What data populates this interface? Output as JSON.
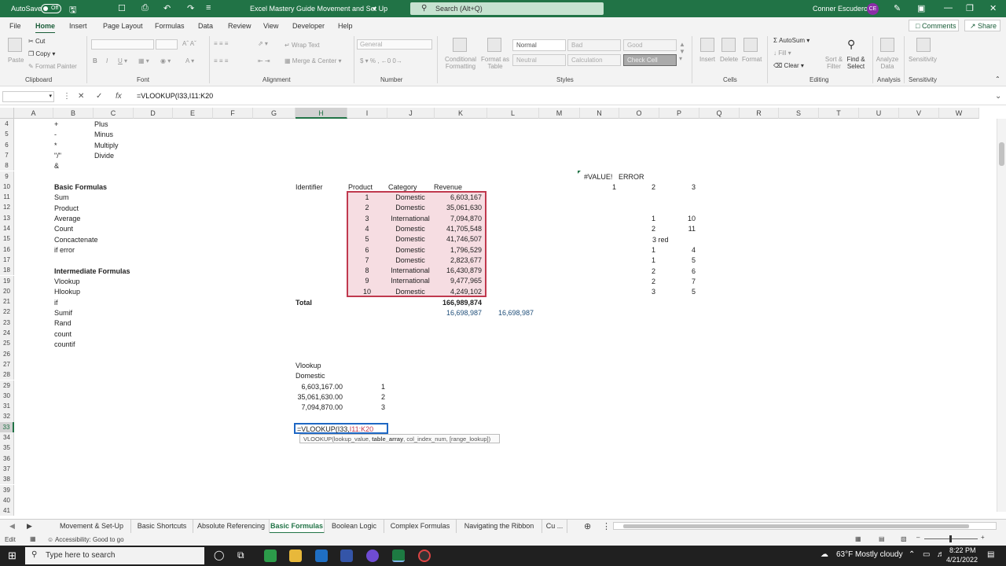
{
  "titlebar": {
    "autosave": "AutoSave",
    "autosave_state": "Off",
    "doc_title": "Excel Mastery Guide Movement and Set Up",
    "search_placeholder": "Search (Alt+Q)",
    "user_name": "Conner Escudero",
    "user_initials": "CE"
  },
  "menu": {
    "items": [
      "File",
      "Home",
      "Insert",
      "Page Layout",
      "Formulas",
      "Data",
      "Review",
      "View",
      "Developer",
      "Help"
    ],
    "comments": "Comments",
    "share": "Share"
  },
  "ribbon": {
    "clipboard": {
      "paste": "Paste",
      "cut": "Cut",
      "copy": "Copy",
      "format_painter": "Format Painter",
      "group": "Clipboard"
    },
    "font": {
      "group": "Font"
    },
    "alignment": {
      "wrap": "Wrap Text",
      "merge": "Merge & Center",
      "group": "Alignment"
    },
    "number": {
      "format": "General",
      "group": "Number"
    },
    "styles": {
      "conditional": "Conditional Formatting",
      "format_table": "Format as Table",
      "normal": "Normal",
      "bad": "Bad",
      "good": "Good",
      "neutral": "Neutral",
      "calculation": "Calculation",
      "check_cell": "Check Cell",
      "group": "Styles"
    },
    "cells": {
      "insert": "Insert",
      "delete": "Delete",
      "format": "Format",
      "group": "Cells"
    },
    "editing": {
      "autosum": "AutoSum",
      "fill": "Fill",
      "clear": "Clear",
      "sort": "Sort & Filter",
      "find": "Find & Select",
      "group": "Editing"
    },
    "analysis": {
      "analyze": "Analyze Data",
      "group": "Analysis"
    },
    "sensitivity": {
      "label": "Sensitivity",
      "group": "Sensitivity"
    }
  },
  "formula_bar": {
    "formula": "=VLOOKUP(I33,I11:K20"
  },
  "columns": [
    "A",
    "B",
    "C",
    "D",
    "E",
    "F",
    "G",
    "H",
    "I",
    "J",
    "K",
    "L",
    "M",
    "N",
    "O",
    "P",
    "Q",
    "R",
    "S",
    "T",
    "U",
    "V",
    "W"
  ],
  "rows": [
    "4",
    "5",
    "6",
    "7",
    "8",
    "9",
    "10",
    "11",
    "12",
    "13",
    "14",
    "15",
    "16",
    "17",
    "18",
    "19",
    "20",
    "21",
    "22",
    "23",
    "24",
    "25",
    "26",
    "27",
    "28",
    "29",
    "30",
    "31",
    "32",
    "33",
    "34",
    "35",
    "36",
    "37",
    "38",
    "39",
    "40",
    "41"
  ],
  "cells": {
    "ops": [
      {
        "sym": "+",
        "name": "Plus"
      },
      {
        "sym": "-",
        "name": "Minus"
      },
      {
        "sym": "*",
        "name": "Multiply"
      },
      {
        "sym": "\"/\"",
        "name": "Divide"
      },
      {
        "sym": "&",
        "name": ""
      }
    ],
    "basic_header": "Basic Formulas",
    "basic": [
      "Sum",
      "Product",
      "Average",
      "Count",
      "Concactenate",
      "if error"
    ],
    "inter_header": "Intermediate Formulas",
    "inter": [
      "Vlookup",
      "Hlookup",
      "if",
      "Sumif",
      "Rand",
      "count",
      "countif"
    ],
    "table_headers": {
      "identifier": "Identifier",
      "product": "Product",
      "category": "Category",
      "revenue": "Revenue"
    },
    "table": [
      {
        "p": "1",
        "c": "Domestic",
        "r": "6,603,167"
      },
      {
        "p": "2",
        "c": "Domestic",
        "r": "35,061,630"
      },
      {
        "p": "3",
        "c": "International",
        "r": "7,094,870"
      },
      {
        "p": "4",
        "c": "Domestic",
        "r": "41,705,548"
      },
      {
        "p": "5",
        "c": "Domestic",
        "r": "41,746,507"
      },
      {
        "p": "6",
        "c": "Domestic",
        "r": "1,796,529"
      },
      {
        "p": "7",
        "c": "Domestic",
        "r": "2,823,677"
      },
      {
        "p": "8",
        "c": "International",
        "r": "16,430,879"
      },
      {
        "p": "9",
        "c": "International",
        "r": "9,477,965"
      },
      {
        "p": "10",
        "c": "Domestic",
        "r": "4,249,102"
      }
    ],
    "total_label": "Total",
    "total": "166,989,874",
    "avg1": "16,698,987",
    "avg2": "16,698,987",
    "value_err": "#VALUE!",
    "error": "ERROR",
    "row10": [
      "1",
      "2",
      "3"
    ],
    "right_grid": [
      {
        "o": "1",
        "p": "10"
      },
      {
        "o": "2",
        "p": "11"
      },
      {
        "o": "3 red",
        "p": ""
      },
      {
        "o": "1",
        "p": "4"
      },
      {
        "o": "1",
        "p": "5"
      },
      {
        "o": "2",
        "p": "6"
      },
      {
        "o": "2",
        "p": "7"
      },
      {
        "o": "3",
        "p": "5"
      }
    ],
    "vlookup_label": "Vlookup",
    "domestic": "Domestic",
    "vl_rows": [
      {
        "v": "6,603,167.00",
        "n": "1"
      },
      {
        "v": "35,061,630.00",
        "n": "2"
      },
      {
        "v": "7,094,870.00",
        "n": "3"
      }
    ],
    "edit_prefix": "=VLOOKUP(I33,",
    "edit_ref": "I11:K20",
    "tooltip_a": "VLOOKUP(lookup_value, ",
    "tooltip_b": "table_array",
    "tooltip_c": ", col_index_num, [range_lookup])"
  },
  "sheet_tabs": [
    "Movement & Set-Up",
    "Basic Shortcuts",
    "Absolute Referencing",
    "Basic Formulas",
    "Boolean Logic",
    "Complex Formulas",
    "Navigating the Ribbon",
    "Cu ..."
  ],
  "status": {
    "mode": "Edit",
    "accessibility": "Accessibility: Good to go"
  },
  "taskbar": {
    "search": "Type here to search",
    "weather": "63°F  Mostly cloudy",
    "time": "8:22 PM",
    "date": "4/21/2022"
  }
}
